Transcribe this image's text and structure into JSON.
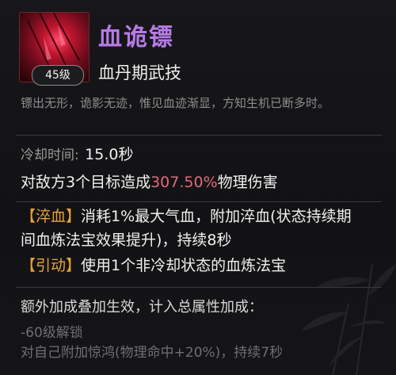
{
  "skill": {
    "name": "血诡镖",
    "level_badge": "45级",
    "type": "血丹期武技",
    "flavor": "镖出无形，诡影无迹，惟见血迹渐显，方知生机已断多时。"
  },
  "stats": {
    "cooldown_label": "冷却时间:",
    "cooldown_value": "15.0秒",
    "damage_prefix": "对敌方3个目标造成",
    "damage_percent": "307.50%",
    "damage_suffix": "物理伤害"
  },
  "effects": [
    {
      "tag": "【淬血】",
      "line1": "消耗1%最大气血，附加淬血(状态持续期",
      "line2": "间血炼法宝效果提升)，持续8秒"
    },
    {
      "tag": "【引动】",
      "line1": "使用1个非冷却状态的血炼法宝"
    }
  ],
  "bonus": {
    "header": "额外加成叠加生效，计入总属性加成：",
    "unlock_text": "-60级解锁",
    "unlock_effect": "对自己附加惊鸿(物理命中+20%)，持续7秒"
  },
  "colors": {
    "name": "#b77be6",
    "highlight": "#e2697a",
    "tag": "#e9a23b",
    "muted": "#6f6f73"
  }
}
